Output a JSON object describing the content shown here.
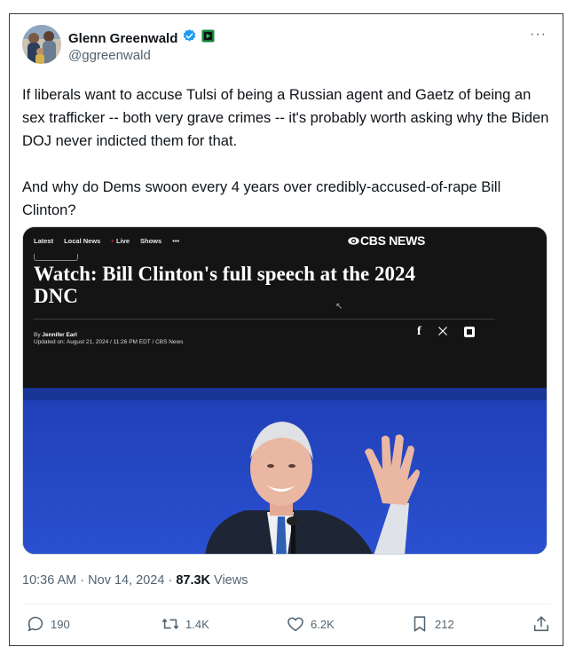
{
  "author": {
    "display_name": "Glenn Greenwald",
    "handle": "@ggreenwald",
    "verified_badge_color": "#1d9bf0",
    "extra_badge_color": "#1a8c3e"
  },
  "more_icon_label": "···",
  "tweet": {
    "text": "If liberals want to accuse Tulsi of being a Russian agent and Gaetz of being an sex trafficker -- both very grave crimes -- it's probably worth asking why the Biden DOJ never indicted them for that.\n\nAnd why do Dems swoon every 4 years over credibly-accused-of-rape Bill Clinton?"
  },
  "media": {
    "nav": [
      "Latest",
      "Local News",
      "Live",
      "Shows",
      "•••"
    ],
    "logo": "CBS NEWS",
    "headline": "Watch: Bill Clinton's full speech at the 2024 DNC",
    "byline_prefix": "By ",
    "byline_author": "Jennifer Earl",
    "updated": "Updated on: August 21, 2024 / 11:26 PM EDT / CBS News",
    "share_icons": [
      "facebook-icon",
      "x-icon",
      "flipboard-icon"
    ],
    "video_bg_color": "#2346c4"
  },
  "meta": {
    "time": "10:36 AM",
    "date": "Nov 14, 2024",
    "sep": " · ",
    "views_count": "87.3K",
    "views_label": " Views"
  },
  "actions": {
    "replies": "190",
    "reposts": "1.4K",
    "likes": "6.2K",
    "bookmarks": "212"
  }
}
